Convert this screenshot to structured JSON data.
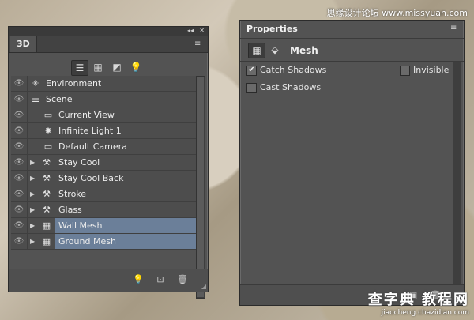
{
  "watermark": {
    "top": "思缘设计论坛 www.missyuan.com",
    "bottom_big": "查字典 教程网",
    "bottom_small": "jiaocheng.chazidian.com"
  },
  "panel3d": {
    "tab": "3D",
    "collapse_glyph": "◂◂",
    "close_glyph": "✕",
    "menu_glyph": "≡",
    "toolbar_icons": [
      {
        "name": "scene-filter-icon",
        "glyph": "☰"
      },
      {
        "name": "mesh-filter-icon",
        "glyph": "▦"
      },
      {
        "name": "material-filter-icon",
        "glyph": "◩"
      },
      {
        "name": "light-filter-icon",
        "glyph": "💡"
      }
    ],
    "layers": [
      {
        "label": "Environment",
        "icon": "✳",
        "eye": "👁"
      },
      {
        "label": "Scene",
        "icon": "☰",
        "eye": "👁"
      },
      {
        "label": "Current View",
        "icon": "▭",
        "eye": "👁"
      },
      {
        "label": "Infinite Light 1",
        "icon": "✸",
        "eye": "👁"
      },
      {
        "label": "Default Camera",
        "icon": "▭",
        "eye": "👁"
      },
      {
        "label": "Stay  Cool",
        "icon": "⚒",
        "eye": "👁",
        "expander": "▶"
      },
      {
        "label": "Stay  Cool Back",
        "icon": "⚒",
        "eye": "👁",
        "expander": "▶"
      },
      {
        "label": "Stroke",
        "icon": "⚒",
        "eye": "👁",
        "expander": "▶"
      },
      {
        "label": "Glass",
        "icon": "⚒",
        "eye": "👁",
        "expander": "▶"
      },
      {
        "label": "Wall Mesh",
        "icon": "▦",
        "eye": "👁",
        "expander": "▶",
        "selected": true
      },
      {
        "label": "Ground Mesh",
        "icon": "▦",
        "eye": "👁",
        "expander": "▶",
        "selected": true
      }
    ],
    "footer": {
      "light_glyph": "💡",
      "new_glyph": "⊡",
      "trash_glyph": "🗑"
    }
  },
  "properties": {
    "tab": "Properties",
    "menu_glyph": "≡",
    "modes": [
      {
        "name": "mesh-mode-icon",
        "glyph": "▦"
      },
      {
        "name": "deform-mode-icon",
        "glyph": "⬙"
      }
    ],
    "title": "Mesh",
    "options": {
      "catch_shadows": {
        "label": "Catch Shadows",
        "checked": true
      },
      "invisible": {
        "label": "Invisible",
        "checked": false
      },
      "cast_shadows": {
        "label": "Cast Shadows",
        "checked": false
      }
    },
    "checkmark": "✔",
    "footer": {
      "render_glyph": "▣",
      "trash_glyph": "🗑"
    }
  }
}
